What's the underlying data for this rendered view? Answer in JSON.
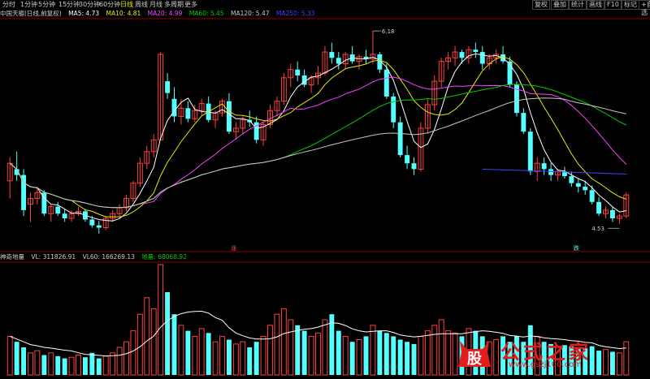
{
  "tabs": [
    "分时",
    "1分钟",
    "5分钟",
    "15分钟",
    "30分钟",
    "60分钟",
    "日线",
    "周线",
    "月线",
    "多周期",
    "更多"
  ],
  "active_tab": "日线",
  "right_buttons": [
    "复权",
    "叠加",
    "统计",
    "画线",
    "F10",
    "标记",
    "+自选"
  ],
  "title": {
    "stock": "中国天楹(日线,前复权)",
    "ma5": "MA5: 4.73",
    "ma10": "MA10: 4.81",
    "ma20": "MA20: 4.99",
    "ma60": "MA60: 5.45",
    "ma120": "MA120: 5.47",
    "ma250": "MA250: 5.33"
  },
  "subtitle": {
    "name": "神奇地量",
    "vl": "VL: 311826.91",
    "vl60": "VL60: 166269.13",
    "dl": "地量: 68068.92"
  },
  "annotations": {
    "high": "6.18",
    "low": "4.53",
    "mark1": "涨",
    "mark2": "跌"
  },
  "colors": {
    "up": "#ff4040",
    "down": "#54ffff",
    "ma5": "#ffffff",
    "ma10": "#e8e800",
    "ma20": "#ff40ff",
    "ma60": "#00cc00",
    "ma120": "#c8c8c8",
    "ma250": "#4040ff",
    "bg": "#000000",
    "grid": "#8b0000"
  },
  "chart_data": {
    "type": "candlestick",
    "candles_ohlc": [
      [
        4.9,
        5.1,
        4.75,
        5.05
      ],
      [
        5.0,
        5.15,
        4.9,
        4.95
      ],
      [
        4.95,
        5.0,
        4.6,
        4.65
      ],
      [
        4.7,
        4.8,
        4.55,
        4.75
      ],
      [
        4.75,
        4.85,
        4.7,
        4.8
      ],
      [
        4.8,
        4.82,
        4.6,
        4.62
      ],
      [
        4.62,
        4.7,
        4.55,
        4.68
      ],
      [
        4.68,
        4.72,
        4.6,
        4.62
      ],
      [
        4.62,
        4.66,
        4.55,
        4.58
      ],
      [
        4.58,
        4.65,
        4.55,
        4.62
      ],
      [
        4.62,
        4.68,
        4.6,
        4.64
      ],
      [
        4.64,
        4.66,
        4.55,
        4.57
      ],
      [
        4.57,
        4.6,
        4.5,
        4.52
      ],
      [
        4.52,
        4.56,
        4.45,
        4.5
      ],
      [
        4.5,
        4.6,
        4.48,
        4.58
      ],
      [
        4.58,
        4.65,
        4.55,
        4.62
      ],
      [
        4.62,
        4.7,
        4.58,
        4.67
      ],
      [
        4.67,
        4.78,
        4.64,
        4.75
      ],
      [
        4.75,
        4.9,
        4.72,
        4.88
      ],
      [
        4.88,
        5.1,
        4.85,
        5.05
      ],
      [
        5.05,
        5.2,
        5.0,
        5.15
      ],
      [
        5.15,
        5.3,
        5.1,
        5.25
      ],
      [
        5.25,
        6.0,
        5.25,
        5.98
      ],
      [
        5.75,
        5.82,
        5.6,
        5.65
      ],
      [
        5.6,
        5.7,
        5.4,
        5.45
      ],
      [
        5.45,
        5.6,
        5.38,
        5.52
      ],
      [
        5.52,
        5.58,
        5.4,
        5.43
      ],
      [
        5.43,
        5.55,
        5.4,
        5.5
      ],
      [
        5.5,
        5.6,
        5.46,
        5.56
      ],
      [
        5.56,
        5.62,
        5.4,
        5.42
      ],
      [
        5.42,
        5.5,
        5.35,
        5.48
      ],
      [
        5.48,
        5.6,
        5.45,
        5.58
      ],
      [
        5.58,
        5.65,
        5.3,
        5.32
      ],
      [
        5.32,
        5.4,
        5.25,
        5.35
      ],
      [
        5.35,
        5.45,
        5.3,
        5.42
      ],
      [
        5.42,
        5.5,
        5.36,
        5.4
      ],
      [
        5.4,
        5.45,
        5.22,
        5.25
      ],
      [
        5.25,
        5.4,
        5.2,
        5.38
      ],
      [
        5.38,
        5.55,
        5.35,
        5.5
      ],
      [
        5.5,
        5.62,
        5.45,
        5.58
      ],
      [
        5.58,
        5.82,
        5.55,
        5.78
      ],
      [
        5.78,
        5.9,
        5.7,
        5.85
      ],
      [
        5.85,
        5.92,
        5.75,
        5.8
      ],
      [
        5.8,
        5.85,
        5.7,
        5.72
      ],
      [
        5.72,
        5.8,
        5.65,
        5.78
      ],
      [
        5.78,
        5.88,
        5.72,
        5.82
      ],
      [
        5.82,
        6.05,
        5.8,
        6.0
      ],
      [
        6.0,
        6.08,
        5.9,
        5.95
      ],
      [
        5.95,
        6.0,
        5.85,
        5.9
      ],
      [
        5.9,
        6.0,
        5.85,
        5.98
      ],
      [
        5.98,
        6.05,
        5.9,
        5.92
      ],
      [
        5.92,
        5.98,
        5.85,
        5.96
      ],
      [
        5.96,
        6.02,
        5.9,
        5.94
      ],
      [
        5.94,
        6.18,
        5.9,
        5.98
      ],
      [
        5.98,
        6.0,
        5.82,
        5.85
      ],
      [
        5.85,
        5.9,
        5.6,
        5.62
      ],
      [
        5.62,
        5.65,
        5.35,
        5.4
      ],
      [
        5.4,
        5.45,
        5.1,
        5.12
      ],
      [
        5.12,
        5.2,
        5.0,
        5.05
      ],
      [
        5.05,
        5.1,
        4.95,
        5.0
      ],
      [
        5.0,
        5.4,
        4.98,
        5.35
      ],
      [
        5.35,
        5.6,
        5.3,
        5.55
      ],
      [
        5.55,
        5.8,
        5.5,
        5.75
      ],
      [
        5.75,
        5.95,
        5.7,
        5.92
      ],
      [
        5.92,
        6.0,
        5.85,
        5.95
      ],
      [
        5.95,
        6.05,
        5.88,
        6.0
      ],
      [
        6.0,
        6.02,
        5.9,
        5.95
      ],
      [
        5.95,
        6.05,
        5.9,
        6.02
      ],
      [
        6.02,
        6.08,
        5.95,
        6.0
      ],
      [
        6.0,
        6.05,
        5.85,
        5.9
      ],
      [
        5.9,
        5.98,
        5.85,
        5.95
      ],
      [
        5.95,
        6.02,
        5.9,
        5.98
      ],
      [
        5.98,
        6.05,
        5.9,
        5.92
      ],
      [
        5.92,
        5.96,
        5.7,
        5.72
      ],
      [
        5.72,
        5.75,
        5.45,
        5.48
      ],
      [
        5.48,
        5.52,
        5.3,
        5.32
      ],
      [
        5.32,
        5.35,
        4.95,
        4.98
      ],
      [
        4.98,
        5.1,
        4.9,
        5.05
      ],
      [
        5.05,
        5.1,
        4.95,
        5.0
      ],
      [
        5.0,
        5.05,
        4.9,
        4.95
      ],
      [
        4.95,
        5.0,
        4.9,
        4.98
      ],
      [
        4.98,
        5.02,
        4.92,
        4.94
      ],
      [
        4.94,
        4.98,
        4.85,
        4.88
      ],
      [
        4.88,
        4.92,
        4.8,
        4.85
      ],
      [
        4.85,
        4.9,
        4.78,
        4.82
      ],
      [
        4.82,
        4.86,
        4.7,
        4.72
      ],
      [
        4.72,
        4.76,
        4.6,
        4.62
      ],
      [
        4.62,
        4.68,
        4.58,
        4.65
      ],
      [
        4.65,
        4.68,
        4.55,
        4.58
      ],
      [
        4.58,
        4.62,
        4.53,
        4.6
      ],
      [
        4.6,
        4.8,
        4.58,
        4.78
      ]
    ],
    "high_label_value": 6.18,
    "low_label_value": 4.53,
    "volume": [
      0.35,
      0.3,
      0.25,
      0.2,
      0.22,
      0.18,
      0.2,
      0.17,
      0.15,
      0.16,
      0.18,
      0.16,
      0.2,
      0.15,
      0.17,
      0.2,
      0.25,
      0.3,
      0.4,
      0.55,
      0.7,
      0.6,
      1.0,
      0.75,
      0.55,
      0.45,
      0.4,
      0.35,
      0.42,
      0.38,
      0.3,
      0.35,
      0.32,
      0.28,
      0.3,
      0.25,
      0.3,
      0.35,
      0.45,
      0.55,
      0.6,
      0.5,
      0.45,
      0.4,
      0.35,
      0.38,
      0.5,
      0.55,
      0.4,
      0.35,
      0.3,
      0.32,
      0.35,
      0.45,
      0.4,
      0.38,
      0.35,
      0.32,
      0.3,
      0.28,
      0.35,
      0.4,
      0.45,
      0.5,
      0.4,
      0.38,
      0.35,
      0.42,
      0.4,
      0.35,
      0.3,
      0.32,
      0.35,
      0.3,
      0.35,
      0.3,
      0.45,
      0.35,
      0.3,
      0.28,
      0.25,
      0.27,
      0.26,
      0.25,
      0.24,
      0.26,
      0.22,
      0.23,
      0.21,
      0.2,
      0.3
    ]
  }
}
